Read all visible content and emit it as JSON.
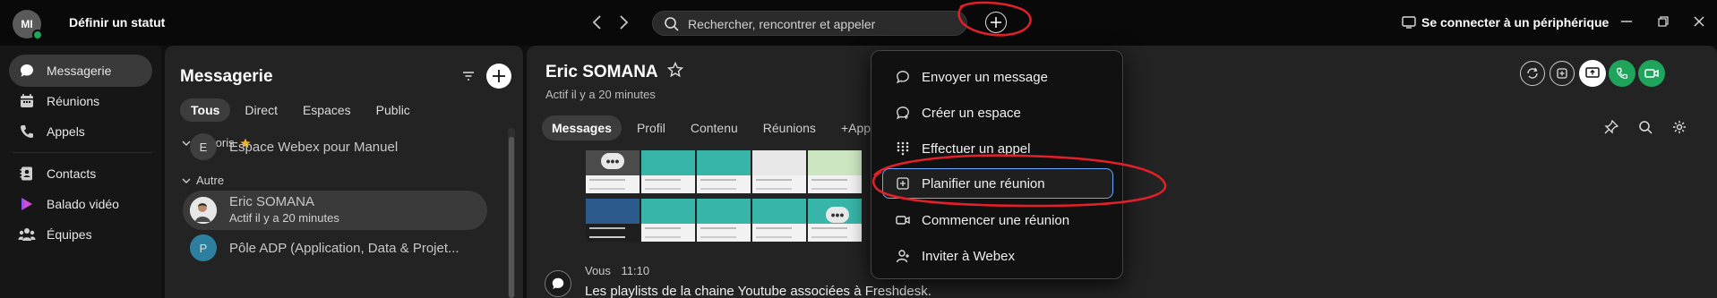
{
  "topbar": {
    "avatar_initials": "MI",
    "status_label": "Définir un statut",
    "search_placeholder": "Rechercher, rencontrer et appeler",
    "connect_label": "Se connecter à un périphérique"
  },
  "leftnav": {
    "items": [
      {
        "label": "Messagerie",
        "icon": "chat-icon"
      },
      {
        "label": "Réunions",
        "icon": "calendar-icon"
      },
      {
        "label": "Appels",
        "icon": "phone-icon"
      },
      {
        "label": "Contacts",
        "icon": "contacts-icon"
      },
      {
        "label": "Balado vidéo",
        "icon": "vidcast-icon"
      },
      {
        "label": "Équipes",
        "icon": "teams-icon"
      }
    ]
  },
  "messaging": {
    "title": "Messagerie",
    "tabs": [
      "Tous",
      "Direct",
      "Espaces",
      "Public"
    ],
    "sections": {
      "favorites": "Favoris",
      "other": "Autre"
    },
    "spaces": [
      {
        "initial": "E",
        "name": "Espace Webex pour Manuel"
      },
      {
        "name": "Eric SOMANA",
        "status": "Actif il y a 20 minutes"
      },
      {
        "initial": "P",
        "name": "Pôle ADP (Application, Data & Projet..."
      }
    ]
  },
  "chat": {
    "name": "Eric SOMANA",
    "status": "Actif il y a 20 minutes",
    "tabs": [
      "Messages",
      "Profil",
      "Contenu",
      "Réunions",
      "+Apps"
    ],
    "message": {
      "sender": "Vous",
      "time": "11:10",
      "text": "Les playlists de la chaine Youtube associées à Freshdesk."
    }
  },
  "dropdown": {
    "items": [
      {
        "label": "Envoyer un message",
        "icon": "message-icon"
      },
      {
        "label": "Créer un espace",
        "icon": "create-space-icon"
      },
      {
        "label": "Effectuer un appel",
        "icon": "dialpad-icon"
      },
      {
        "label": "Planifier une réunion",
        "icon": "schedule-icon"
      },
      {
        "label": "Commencer une réunion",
        "icon": "video-icon"
      },
      {
        "label": "Inviter à Webex",
        "icon": "invite-icon"
      }
    ]
  },
  "colors": {
    "accent_green": "#1fa45b",
    "selection_blue": "#6aa9ff",
    "annotation_red": "#e3202a"
  }
}
